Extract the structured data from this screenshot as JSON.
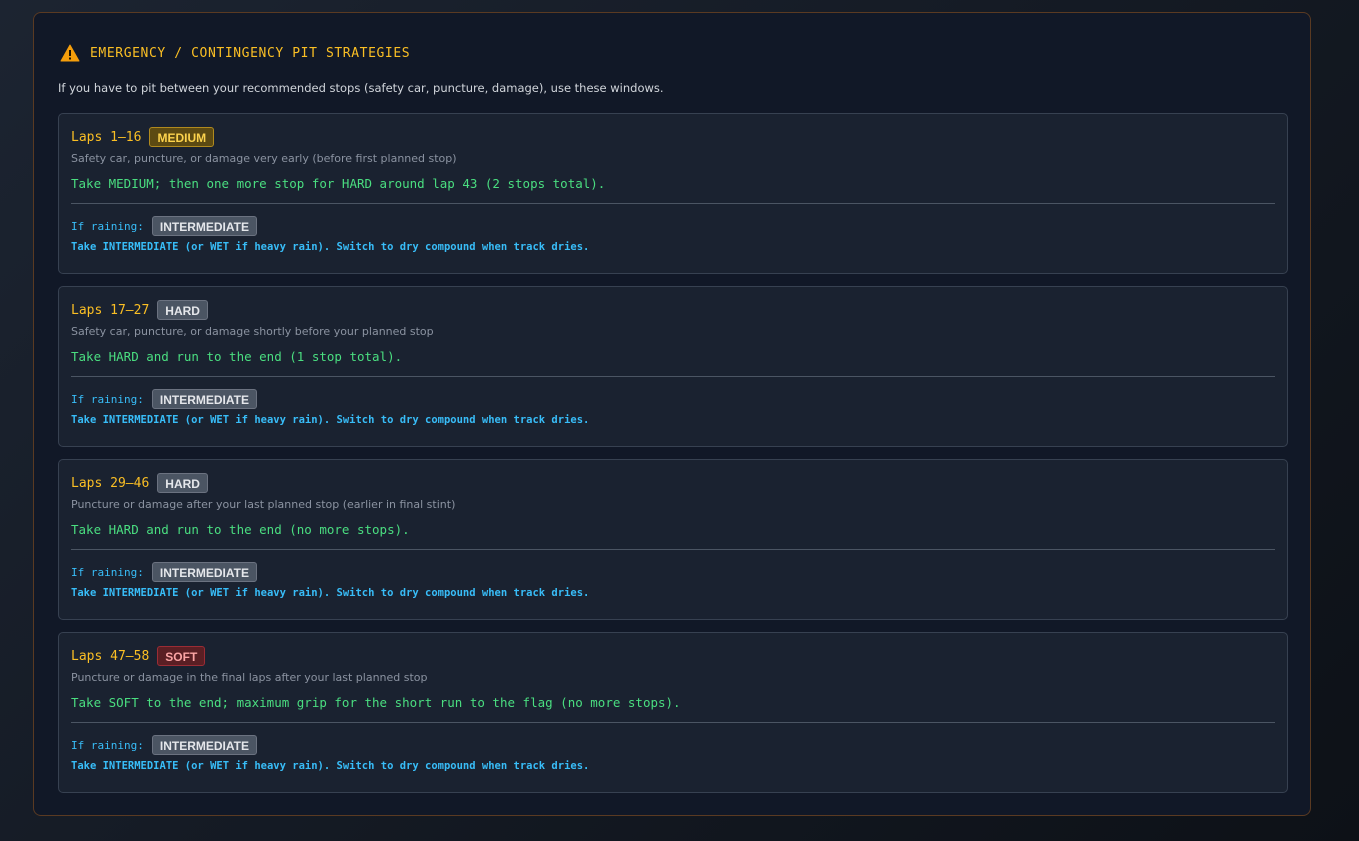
{
  "panel": {
    "title": "EMERGENCY / CONTINGENCY PIT STRATEGIES",
    "icon": "warning-icon",
    "intro": "If you have to pit between your recommended stops (safety car, puncture, damage), use these windows."
  },
  "colors": {
    "accent": "#fbbf24",
    "action": "#4ade80",
    "rain": "#38bdf8",
    "medium": "#fcd34d",
    "hard": "#e5e7eb",
    "soft": "#fca5a5"
  },
  "windows": [
    {
      "laps": "Laps 1–16",
      "tyre": "MEDIUM",
      "scenario": "Safety car, puncture, or damage very early (before first planned stop)",
      "action": "Take MEDIUM; then one more stop for HARD around lap 43 (2 stops total).",
      "rain_label": "If raining:",
      "rain_tyre": "INTERMEDIATE",
      "rain_action": "Take INTERMEDIATE (or WET if heavy rain). Switch to dry compound when track dries."
    },
    {
      "laps": "Laps 17–27",
      "tyre": "HARD",
      "scenario": "Safety car, puncture, or damage shortly before your planned stop",
      "action": "Take HARD and run to the end (1 stop total).",
      "rain_label": "If raining:",
      "rain_tyre": "INTERMEDIATE",
      "rain_action": "Take INTERMEDIATE (or WET if heavy rain). Switch to dry compound when track dries."
    },
    {
      "laps": "Laps 29–46",
      "tyre": "HARD",
      "scenario": "Puncture or damage after your last planned stop (earlier in final stint)",
      "action": "Take HARD and run to the end (no more stops).",
      "rain_label": "If raining:",
      "rain_tyre": "INTERMEDIATE",
      "rain_action": "Take INTERMEDIATE (or WET if heavy rain). Switch to dry compound when track dries."
    },
    {
      "laps": "Laps 47–58",
      "tyre": "SOFT",
      "scenario": "Puncture or damage in the final laps after your last planned stop",
      "action": "Take SOFT to the end; maximum grip for the short run to the flag (no more stops).",
      "rain_label": "If raining:",
      "rain_tyre": "INTERMEDIATE",
      "rain_action": "Take INTERMEDIATE (or WET if heavy rain). Switch to dry compound when track dries."
    }
  ]
}
